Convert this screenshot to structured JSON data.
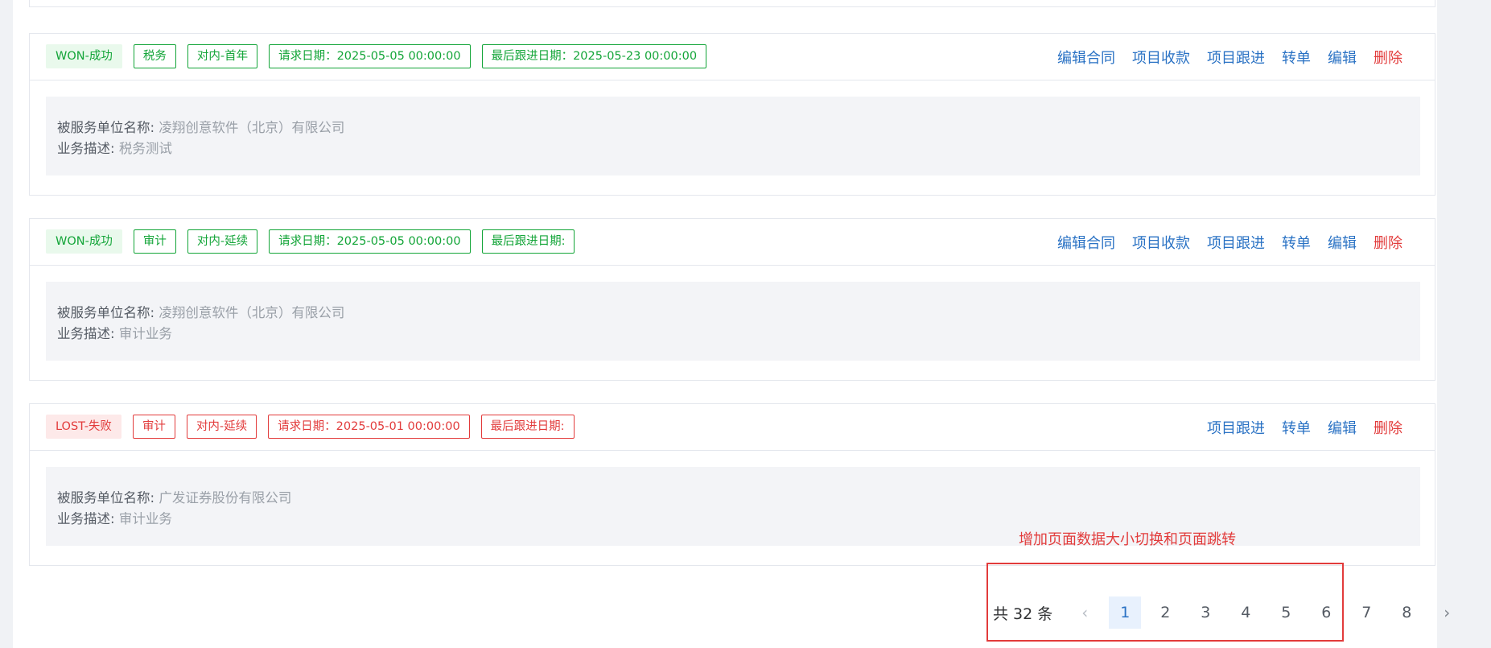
{
  "cards": [
    {
      "tags": [
        {
          "text": "WON-成功",
          "kind": "status",
          "color": "green"
        },
        {
          "text": "税务",
          "kind": "outline",
          "color": "green"
        },
        {
          "text": "对内-首年",
          "kind": "outline",
          "color": "green"
        },
        {
          "text": "请求日期：2025-05-05 00:00:00",
          "kind": "outline",
          "color": "green"
        },
        {
          "text": "最后跟进日期：2025-05-23 00:00:00",
          "kind": "outline",
          "color": "green"
        }
      ],
      "actions": [
        {
          "text": "编辑合同",
          "danger": false
        },
        {
          "text": "项目收款",
          "danger": false
        },
        {
          "text": "项目跟进",
          "danger": false
        },
        {
          "text": "转单",
          "danger": false
        },
        {
          "text": "编辑",
          "danger": false
        },
        {
          "text": "删除",
          "danger": true
        }
      ],
      "client_label": "被服务单位名称:",
      "client": "凌翔创意软件（北京）有限公司",
      "desc_label": "业务描述:",
      "desc": "税务测试"
    },
    {
      "tags": [
        {
          "text": "WON-成功",
          "kind": "status",
          "color": "green"
        },
        {
          "text": "审计",
          "kind": "outline",
          "color": "green"
        },
        {
          "text": "对内-延续",
          "kind": "outline",
          "color": "green"
        },
        {
          "text": "请求日期：2025-05-05 00:00:00",
          "kind": "outline",
          "color": "green"
        },
        {
          "text": "最后跟进日期:",
          "kind": "outline",
          "color": "green"
        }
      ],
      "actions": [
        {
          "text": "编辑合同",
          "danger": false
        },
        {
          "text": "项目收款",
          "danger": false
        },
        {
          "text": "项目跟进",
          "danger": false
        },
        {
          "text": "转单",
          "danger": false
        },
        {
          "text": "编辑",
          "danger": false
        },
        {
          "text": "删除",
          "danger": true
        }
      ],
      "client_label": "被服务单位名称:",
      "client": "凌翔创意软件（北京）有限公司",
      "desc_label": "业务描述:",
      "desc": "审计业务"
    },
    {
      "tags": [
        {
          "text": "LOST-失败",
          "kind": "status",
          "color": "red"
        },
        {
          "text": "审计",
          "kind": "outline",
          "color": "red"
        },
        {
          "text": "对内-延续",
          "kind": "outline",
          "color": "red"
        },
        {
          "text": "请求日期：2025-05-01 00:00:00",
          "kind": "outline",
          "color": "red"
        },
        {
          "text": "最后跟进日期:",
          "kind": "outline",
          "color": "red"
        }
      ],
      "actions": [
        {
          "text": "项目跟进",
          "danger": false
        },
        {
          "text": "转单",
          "danger": false
        },
        {
          "text": "编辑",
          "danger": false
        },
        {
          "text": "删除",
          "danger": true
        }
      ],
      "client_label": "被服务单位名称:",
      "client": "广发证券股份有限公司",
      "desc_label": "业务描述:",
      "desc": "审计业务"
    }
  ],
  "annotation": "增加页面数据大小切换和页面跳转",
  "pagination": {
    "total": "共 32 条",
    "pages": [
      "1",
      "2",
      "3",
      "4",
      "5",
      "6",
      "7",
      "8"
    ],
    "current": "1"
  },
  "colors": {
    "link": "#2a72c4",
    "danger": "#e23b3b",
    "success": "#13a538"
  }
}
